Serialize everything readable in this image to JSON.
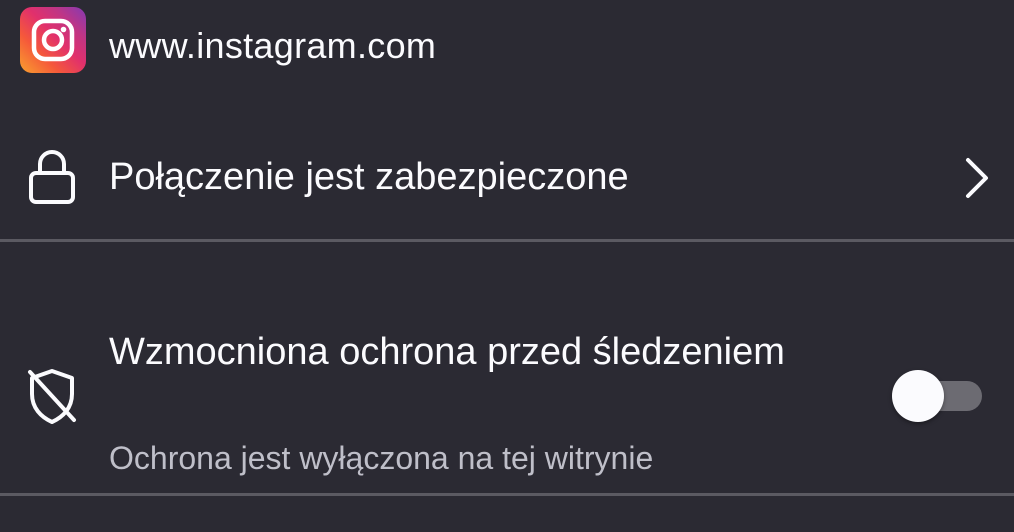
{
  "site": {
    "icon": "instagram-icon",
    "url": "www.instagram.com"
  },
  "connection": {
    "icon": "lock-icon",
    "label": "Połączenie jest zabezpieczone",
    "chevron_icon": "chevron-right-icon"
  },
  "tracking_protection": {
    "icon": "shield-off-icon",
    "title": "Wzmocniona ochrona przed śledzeniem",
    "subtitle": "Ochrona jest wyłączona na tej witrynie",
    "toggle_enabled": false
  },
  "colors": {
    "background": "#2b2a33",
    "text": "#fbfbfe",
    "secondary_text": "#bfbfc9",
    "divider": "#5b5a62",
    "toggle_track": "#6c6b72",
    "toggle_thumb": "#fbfbfe"
  }
}
